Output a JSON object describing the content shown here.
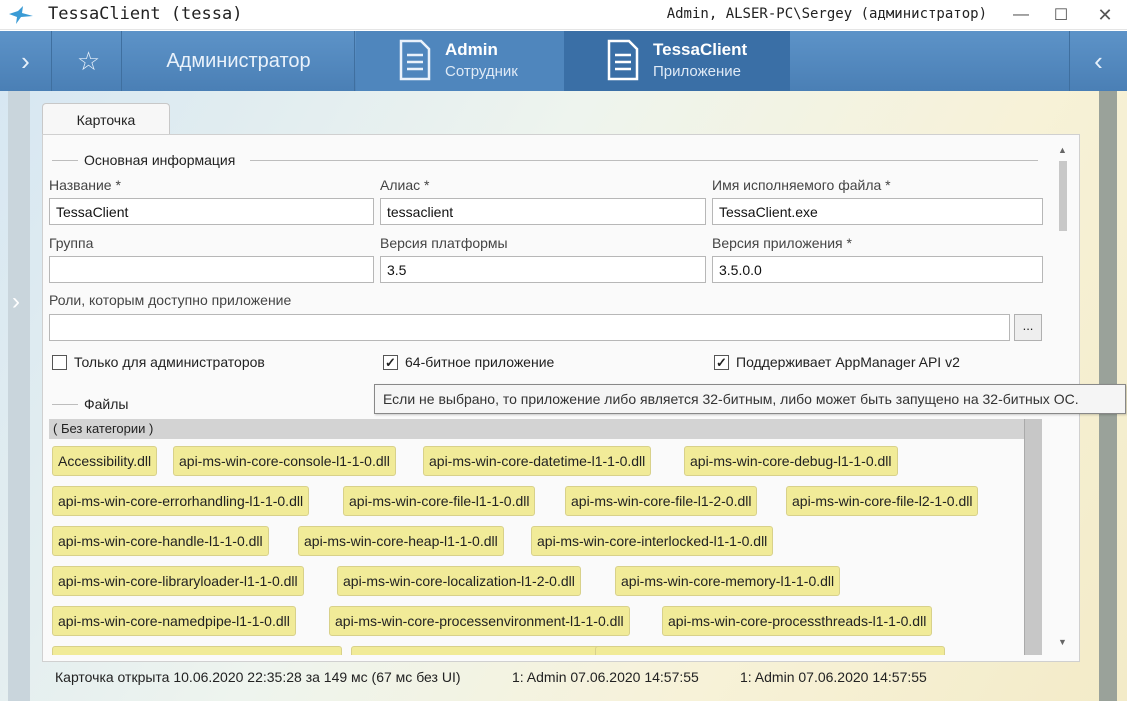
{
  "window": {
    "title": "TessaClient (tessa)",
    "user": "Admin, ALSER-PC\\Sergey (администратор)",
    "min_glyph": "—",
    "max_glyph": "☐",
    "close_glyph": "✕"
  },
  "tabbar": {
    "expand_glyph": "›",
    "fav_glyph": "☆",
    "collapse_glyph": "‹",
    "role_tab": "Администратор",
    "tabs": [
      {
        "title": "Admin",
        "subtitle": "Сотрудник"
      },
      {
        "title": "TessaClient",
        "subtitle": "Приложение"
      }
    ]
  },
  "sidebar": {
    "left_arrow": "›"
  },
  "card": {
    "tab_label": "Карточка",
    "main_section": "Основная информация",
    "fields": {
      "name": {
        "label": "Название  *",
        "value": "TessaClient"
      },
      "alias": {
        "label": "Алиас  *",
        "value": "tessaclient"
      },
      "exe": {
        "label": "Имя исполняемого файла  *",
        "value": "TessaClient.exe"
      },
      "group": {
        "label": "Группа",
        "value": ""
      },
      "platform_version": {
        "label": "Версия платформы",
        "value": "3.5"
      },
      "app_version": {
        "label": "Версия приложения  *",
        "value": "3.5.0.0"
      },
      "roles": {
        "label": "Роли, которым доступно приложение",
        "value": ""
      }
    },
    "browse_label": "...",
    "checkboxes": [
      {
        "label": "Только для администраторов",
        "checked": false,
        "mark": ""
      },
      {
        "label": "64-битное приложение",
        "checked": true,
        "mark": "✓"
      },
      {
        "label": "Поддерживает AppManager API v2",
        "checked": true,
        "mark": "✓"
      }
    ],
    "tooltip": "Если не выбрано, то приложение либо является 32-битным, либо может быть запущено на 32-битных ОС.",
    "files_section": "Файлы",
    "files_category": "( Без категории )",
    "files": [
      "Accessibility.dll",
      "api-ms-win-core-console-l1-1-0.dll",
      "api-ms-win-core-datetime-l1-1-0.dll",
      "api-ms-win-core-debug-l1-1-0.dll",
      "api-ms-win-core-errorhandling-l1-1-0.dll",
      "api-ms-win-core-file-l1-1-0.dll",
      "api-ms-win-core-file-l1-2-0.dll",
      "api-ms-win-core-file-l2-1-0.dll",
      "api-ms-win-core-handle-l1-1-0.dll",
      "api-ms-win-core-heap-l1-1-0.dll",
      "api-ms-win-core-interlocked-l1-1-0.dll",
      "api-ms-win-core-libraryloader-l1-1-0.dll",
      "api-ms-win-core-localization-l1-2-0.dll",
      "api-ms-win-core-memory-l1-1-0.dll",
      "api-ms-win-core-namedpipe-l1-1-0.dll",
      "api-ms-win-core-processenvironment-l1-1-0.dll",
      "api-ms-win-core-processthreads-l1-1-0.dll"
    ]
  },
  "status": {
    "opened": "Карточка открыта 10.06.2020 22:35:28 за 149 мс (67 мс без UI)",
    "created": "1:  Admin  07.06.2020 14:57:55",
    "modified": "1:  Admin  07.06.2020 14:57:55"
  },
  "colors": {
    "tabbar": "#4a7fb5",
    "file_chip": "#f1eb98",
    "category_bar": "#d3d3d3"
  }
}
